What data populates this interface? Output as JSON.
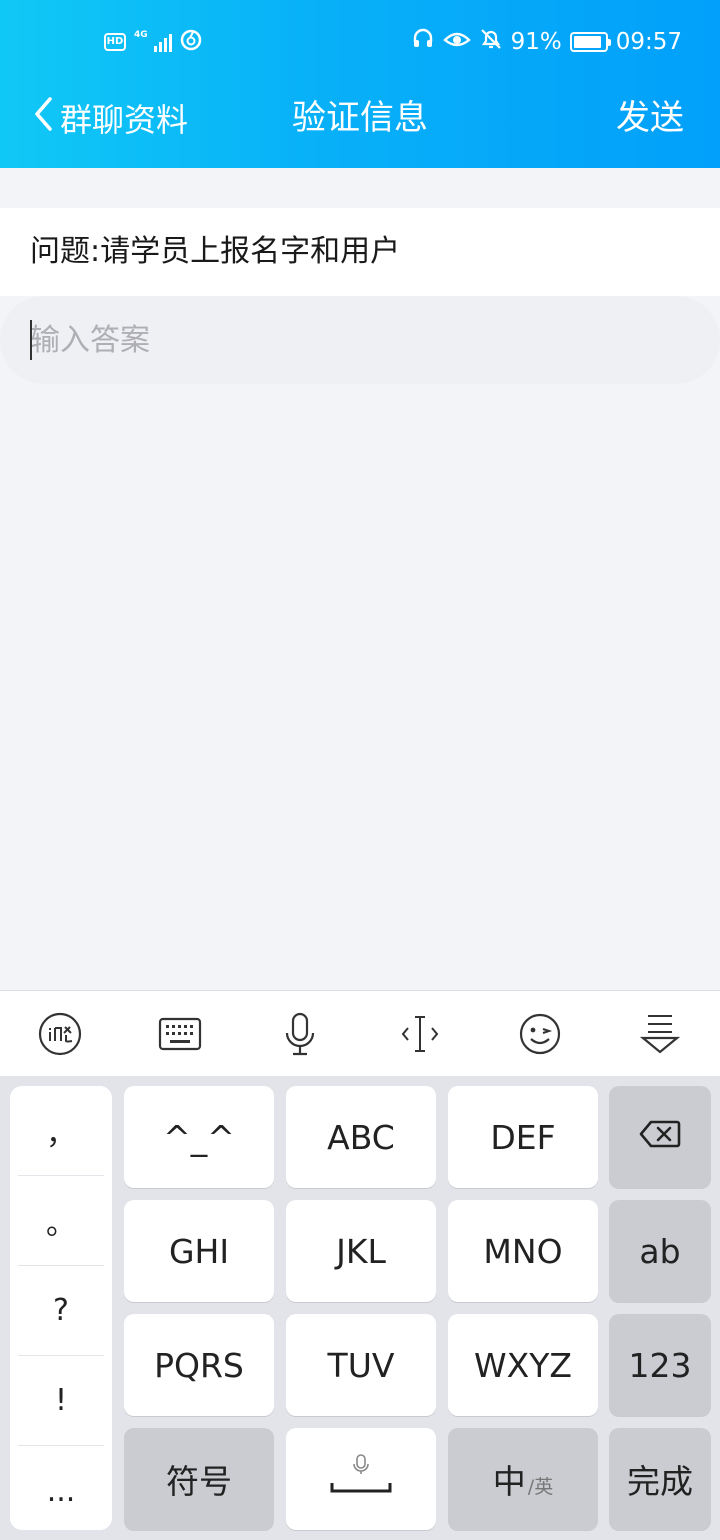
{
  "status_bar": {
    "hd": "HD",
    "network": "4G",
    "battery": "91%",
    "time": "09:57",
    "icons": [
      "hd-icon",
      "signal-4g-icon",
      "netease-music-icon",
      "headset-icon",
      "eye-comfort-icon",
      "silent-bell-icon",
      "battery-icon"
    ]
  },
  "nav": {
    "back_label": "群聊资料",
    "title": "验证信息",
    "send_label": "发送"
  },
  "form": {
    "question": "问题:请学员上报名字和用户",
    "answer_value": "",
    "answer_placeholder": "输入答案"
  },
  "keyboard": {
    "toolbar": [
      "xunfei-logo-icon",
      "keyboard-icon",
      "microphone-icon",
      "cursor-move-icon",
      "emoji-icon",
      "hide-keyboard-icon"
    ],
    "punctuation": [
      "，",
      "。",
      "?",
      "!",
      "..."
    ],
    "rows": [
      [
        "^_^",
        "ABC",
        "DEF"
      ],
      [
        "GHI",
        "JKL",
        "MNO"
      ],
      [
        "PQRS",
        "TUV",
        "WXYZ"
      ]
    ],
    "side_keys": [
      "ab",
      "123"
    ],
    "bottom": {
      "symbols": "符号",
      "lang_main": "中",
      "lang_sub": "/英",
      "done": "完成"
    }
  }
}
